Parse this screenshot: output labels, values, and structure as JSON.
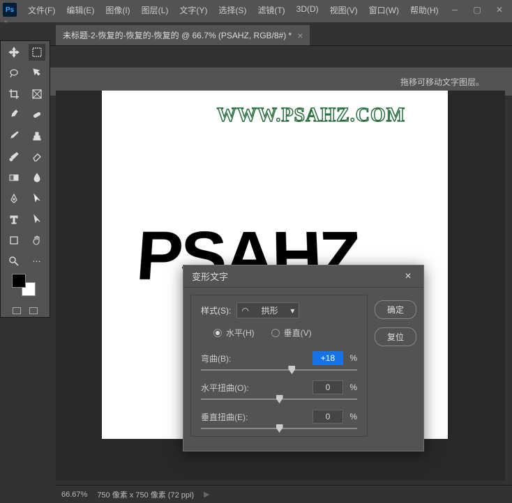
{
  "app": {
    "logo": "Ps"
  },
  "menu": {
    "items": [
      "文件(F)",
      "编辑(E)",
      "图像(I)",
      "图层(L)",
      "文字(Y)",
      "选择(S)",
      "滤镜(T)",
      "3D(D)",
      "视图(V)",
      "窗口(W)",
      "帮助(H)"
    ]
  },
  "tab": {
    "title": "未标题-2-恢复的-恢复的-恢复的 @ 66.7% (PSAHZ, RGB/8#) *",
    "close": "×"
  },
  "tooltip": "拖移可移动文字图层。",
  "canvas": {
    "watermark": "WWW.PSAHZ.COM",
    "main_text": "PSAHZ"
  },
  "dialog": {
    "title": "变形文字",
    "close": "×",
    "style_label": "样式(S):",
    "style_value": "拱形",
    "radio_h": "水平(H)",
    "radio_v": "垂直(V)",
    "bend_label": "弯曲(B):",
    "bend_value": "+18",
    "hdist_label": "水平扭曲(O):",
    "hdist_value": "0",
    "vdist_label": "垂直扭曲(E):",
    "vdist_value": "0",
    "percent": "%",
    "ok": "确定",
    "reset": "复位"
  },
  "status": {
    "zoom": "66.67%",
    "dims": "750 像素 x 750 像素 (72 ppi)",
    "arrow": "▶"
  }
}
